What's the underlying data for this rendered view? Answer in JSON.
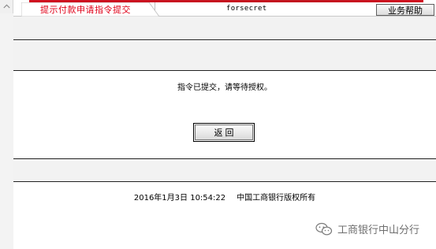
{
  "header": {
    "tab_label": "提示付款申请指令提交",
    "title": "forsecret",
    "help_label": "业务帮助"
  },
  "main": {
    "message": "指令已提交，请等待授权。",
    "return_label": "返 回"
  },
  "footer": {
    "date": "2016年1月3日 10:54:22",
    "copyright": "中国工商银行版权所有"
  },
  "watermark": {
    "text": "工商银行中山分行"
  },
  "icons": {
    "scroll_up": "chevron-up-icon",
    "wechat": "wechat-icon"
  },
  "colors": {
    "accent_red": "#d01020",
    "tab_text": "#e00018",
    "band_bg": "#f2f2f2"
  }
}
